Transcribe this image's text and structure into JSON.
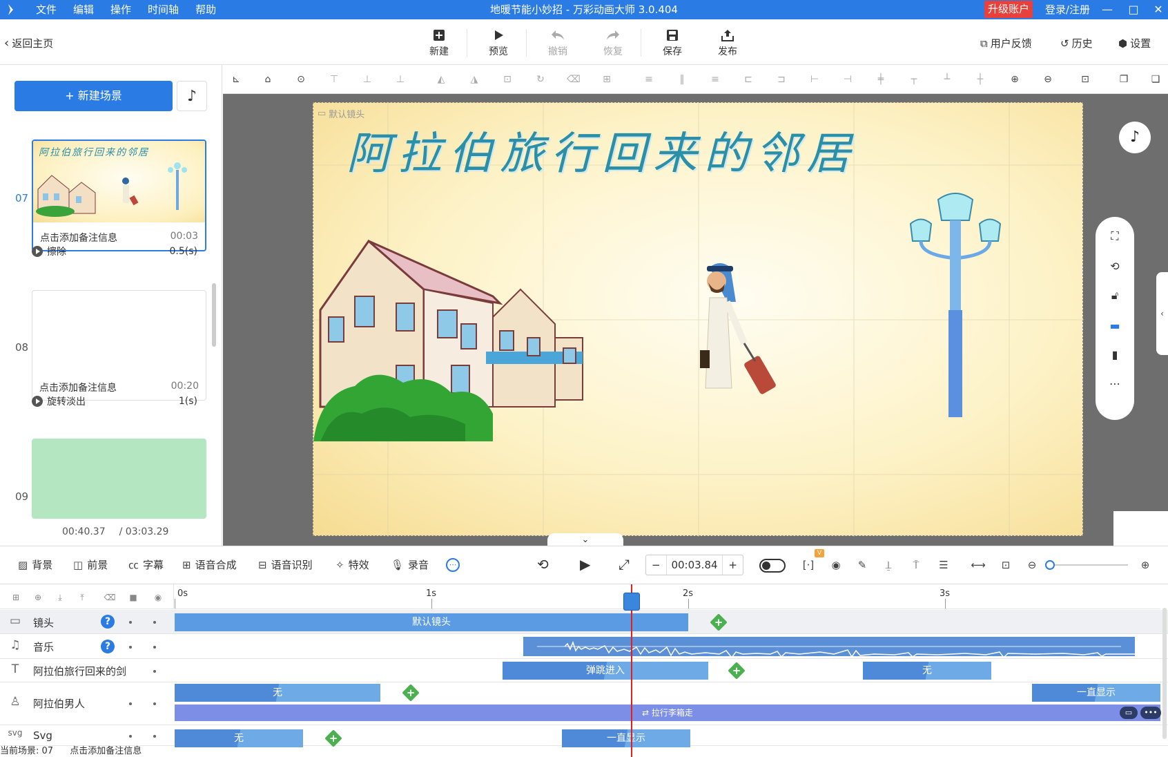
{
  "titlebar": {
    "menu": [
      "文件",
      "编辑",
      "操作",
      "时间轴",
      "帮助"
    ],
    "title": "地暖节能小妙招 - 万彩动画大师 3.0.404",
    "upgrade": "升级账户",
    "login": "登录/注册"
  },
  "toolbar": {
    "back": "返回主页",
    "new": "新建",
    "preview": "预览",
    "undo": "撤销",
    "redo": "恢复",
    "save": "保存",
    "publish": "发布",
    "feedback": "用户反馈",
    "history": "历史",
    "settings": "设置"
  },
  "left": {
    "new_scene": "新建场景",
    "scenes": [
      {
        "num": "07",
        "note": "点击添加备注信息",
        "time": "00:03",
        "thumb_title": "阿拉伯旅行回来的邻居"
      },
      {
        "num": "08",
        "note": "点击添加备注信息",
        "time": "00:20"
      },
      {
        "num": "09"
      }
    ],
    "transitions": [
      {
        "name": "擦除",
        "dur": "0.5(s)"
      },
      {
        "name": "旋转淡出",
        "dur": "1(s)"
      }
    ],
    "current_time": "00:40.37",
    "total_time": "/ 03:03.29"
  },
  "stage": {
    "camera_label": "默认镜头",
    "title": "阿拉伯旅行回来的邻居"
  },
  "timeline_toolbar": {
    "background": "背景",
    "foreground": "前景",
    "subtitle": "字幕",
    "tts": "语音合成",
    "asr": "语音识别",
    "effects": "特效",
    "record": "录音",
    "time": "00:03.84",
    "minus": "−",
    "plus": "+",
    "badge": "V"
  },
  "timeline": {
    "ruler": [
      "0s",
      "1s",
      "2s",
      "3s"
    ],
    "tracks": [
      {
        "name": "镜头",
        "clips": [
          "默认镜头"
        ]
      },
      {
        "name": "音乐"
      },
      {
        "name": "阿拉伯旅行回来的剑",
        "clips": [
          "弹跳进入",
          "无"
        ]
      },
      {
        "name": "阿拉伯男人",
        "clips": [
          "无",
          "一直显示",
          "拉行李箱走"
        ]
      },
      {
        "name": "Svg",
        "clips": [
          "无",
          "一直显示"
        ]
      }
    ]
  },
  "status": {
    "current_scene": "当前场景: 07",
    "note": "点击添加备注信息"
  },
  "colors": {
    "accent": "#2a7be4",
    "upgrade": "#e8403a",
    "clip_blue": "#5b9be3",
    "clip_purple": "#7c8ee6",
    "keyframe": "#4caf50",
    "playhead": "#e02020"
  }
}
